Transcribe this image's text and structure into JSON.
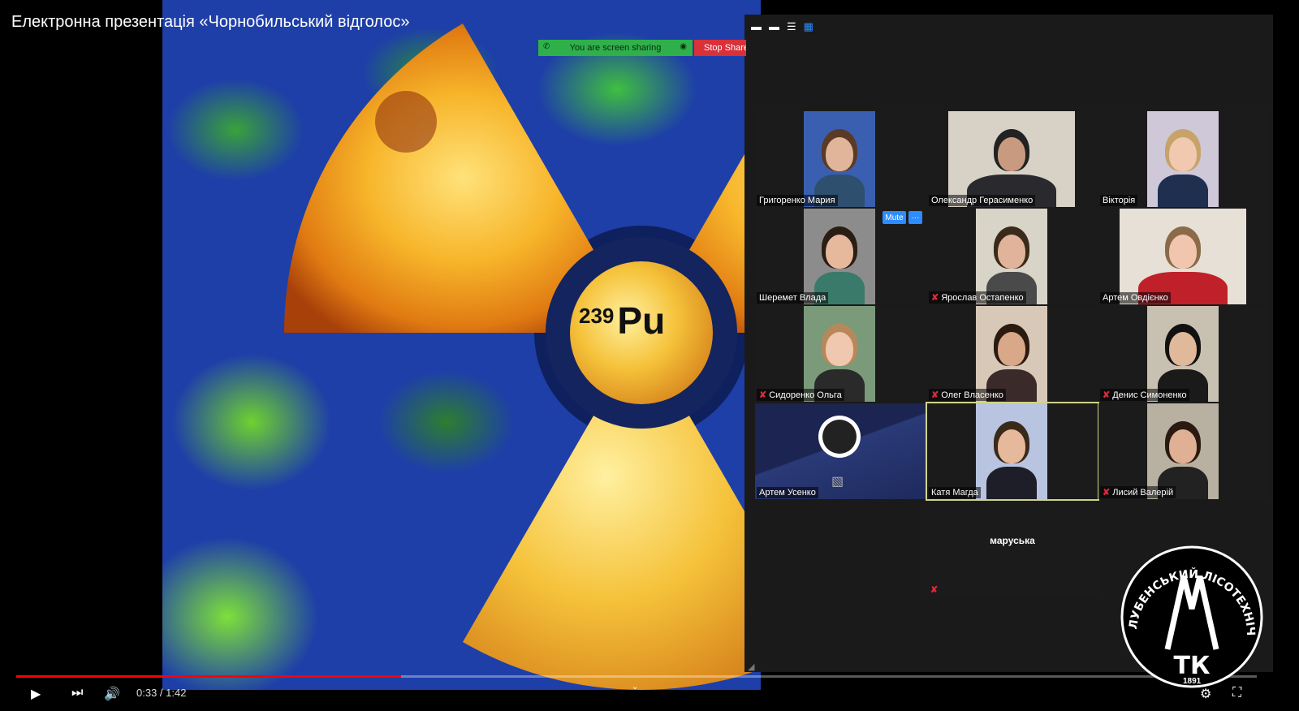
{
  "video": {
    "title": "Електронна презентація «Чорнобильський відголос»",
    "time": "0:33 / 1:42",
    "progress_fraction": 0.31
  },
  "slide": {
    "isotope_mass": "239",
    "element_symbol": "Pu"
  },
  "zoom": {
    "share_text": "You are screen sharing",
    "stop_share_label": "Stop Share",
    "mute_label": "Mute",
    "more_label": "···",
    "view_icons": [
      "minimize-icon",
      "single-window-icon",
      "speaker-view-icon",
      "gallery-view-icon"
    ],
    "participants": [
      {
        "name": "Григоренко Мария",
        "muted": false
      },
      {
        "name": "Олександр Герасименко",
        "muted": false
      },
      {
        "name": "Вікторія",
        "muted": false
      },
      {
        "name": "Шеремет Влада",
        "muted": false
      },
      {
        "name": "Ярослав Остапенко",
        "muted": true
      },
      {
        "name": "Артем Овдієнко",
        "muted": false
      },
      {
        "name": "Сидоренко Ольга",
        "muted": true
      },
      {
        "name": "Олег Власенко",
        "muted": true
      },
      {
        "name": "Денис Симоненко",
        "muted": true
      },
      {
        "name": "Артем Усенко",
        "muted": false
      },
      {
        "name": "Катя Магда",
        "muted": false
      },
      {
        "name": "Лисий Валерій",
        "muted": true
      },
      {
        "name": "маруська",
        "muted": true
      }
    ]
  },
  "logo": {
    "text": "ЛУБЕНСЬКИЙ ЛІСОТЕХНІЧНИЙ КОЛЕДЖ",
    "initials": "ТК",
    "year": "1891"
  },
  "colors": {
    "zoom_accent": "#2d8cff",
    "share_green": "#2fb04b",
    "stop_red": "#d9303a",
    "progress_red": "#ff0000",
    "mic_off_red": "#e0283a"
  }
}
